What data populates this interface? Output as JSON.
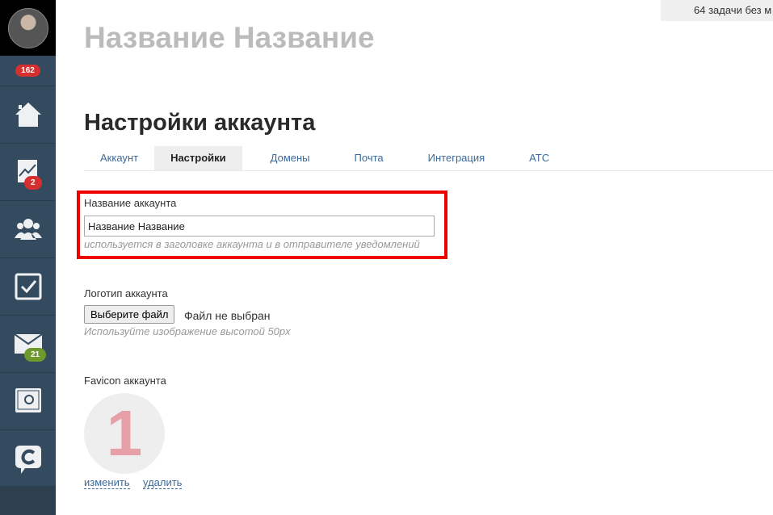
{
  "sidebar": {
    "notifications": "162",
    "analytics_badge": "2",
    "mail_badge": "21",
    "colors": {
      "bg": "#344a5f",
      "red": "#d62f2f",
      "green": "#6e9a2c"
    }
  },
  "topbar": {
    "tasks": "64 задачи без м"
  },
  "header": {
    "account_name": "Название Название",
    "page_title": "Настройки аккаунта"
  },
  "tabs": [
    {
      "label": "Аккаунт"
    },
    {
      "label": "Настройки"
    },
    {
      "label": "Домены"
    },
    {
      "label": "Почта"
    },
    {
      "label": "Интеграция"
    },
    {
      "label": "АТС"
    }
  ],
  "form": {
    "name_label": "Название аккаунта",
    "name_value": "Название Название",
    "name_hint": "используется в заголовке аккаунта и в отправителе уведомлений",
    "logo_label": "Логотип аккаунта",
    "file_button": "Выберите файл",
    "file_status": "Файл не выбран",
    "logo_hint": "Используйте изображение высотой 50px",
    "favicon_label": "Favicon аккаунта",
    "favicon_char": "1",
    "change": "изменить",
    "delete": "удалить"
  }
}
